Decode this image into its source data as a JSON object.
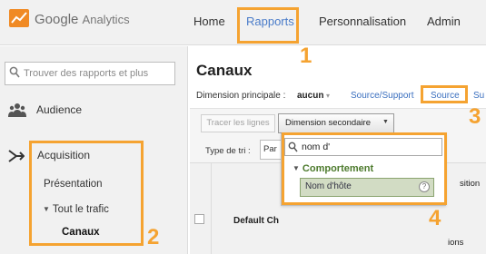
{
  "header": {
    "logo_text": "Google",
    "logo_sub": "Analytics",
    "nav": {
      "home": "Home",
      "reports": "Rapports",
      "customization": "Personnalisation",
      "admin": "Admin"
    }
  },
  "sidebar": {
    "search_placeholder": "Trouver des rapports et plus",
    "audience": "Audience",
    "acquisition": "Acquisition",
    "overview": "Présentation",
    "all_traffic": "Tout le trafic",
    "channels": "Canaux"
  },
  "main": {
    "title": "Canaux",
    "primary_dimension_label": "Dimension principale :",
    "primary_dimension_value": "aucun",
    "dimension_options": [
      "Source/Support",
      "Source",
      "Su"
    ],
    "plot_rows_button": "Tracer les lignes",
    "secondary_dimension_button": "Dimension secondaire",
    "sort_label": "Type de tri :",
    "sort_value": "Par",
    "table": {
      "row_label": "Default Ch",
      "acquisition_header": "sition",
      "sessions_header": "ions"
    }
  },
  "dropdown": {
    "search_value": "nom d'",
    "category": "Comportement",
    "option": "Nom d'hôte",
    "help": "?"
  },
  "callouts": [
    "1",
    "2",
    "3",
    "4"
  ],
  "colors": {
    "callout": "#f5a331",
    "link": "#3a6fbf",
    "category_green": "#4c7a2c",
    "option_bg": "#d2dcc4",
    "logo_orange": "#f08a24"
  },
  "icons": {
    "logo": "google-analytics-logo-icon",
    "search": "search-icon",
    "audience": "people-icon",
    "acquisition": "arrows-merge-icon",
    "help": "help-icon"
  }
}
